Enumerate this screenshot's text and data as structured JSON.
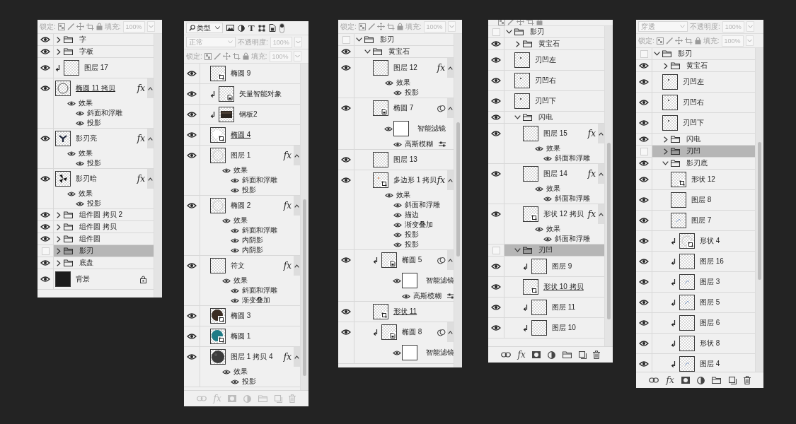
{
  "panels": [
    {
      "lock": {
        "label": "锁定:",
        "fill_label": "填充:",
        "fill": "100%"
      },
      "layers": [
        {
          "kind": "group",
          "name": "字",
          "expanded": false,
          "visible": true,
          "selected": false
        },
        {
          "kind": "group",
          "name": "字板",
          "expanded": false,
          "visible": true,
          "selected": false
        },
        {
          "kind": "layer",
          "name": "图层 17",
          "visible": true,
          "selected": false,
          "clipped": true,
          "thumb": {
            "kind": "checker"
          }
        },
        {
          "kind": "layer",
          "name": "椭圆 11 拷贝",
          "visible": true,
          "selected": false,
          "linked": true,
          "thumb": {
            "kind": "ring"
          },
          "badge": "fx",
          "effects": {
            "label": "效果",
            "items": [
              "斜面和浮雕",
              "投影"
            ]
          }
        },
        {
          "kind": "layer",
          "name": "影刃亮",
          "visible": true,
          "selected": false,
          "thumb": {
            "kind": "blade"
          },
          "badge": "fx",
          "effects": {
            "label": "效果",
            "items": [
              "投影"
            ]
          }
        },
        {
          "kind": "layer",
          "name": "影刃暗",
          "visible": true,
          "selected": false,
          "thumb": {
            "kind": "fan"
          },
          "badge": "fx",
          "effects": {
            "label": "效果",
            "items": [
              "投影"
            ]
          }
        },
        {
          "kind": "group",
          "name": "组件圆 拷贝 2",
          "expanded": false,
          "visible": true,
          "selected": false
        },
        {
          "kind": "group",
          "name": "组件圆 拷贝",
          "expanded": false,
          "visible": true,
          "selected": false
        },
        {
          "kind": "group",
          "name": "组件圆",
          "expanded": false,
          "visible": true,
          "selected": false
        },
        {
          "kind": "group",
          "name": "影刃",
          "expanded": false,
          "visible": false,
          "selected": true
        },
        {
          "kind": "group",
          "name": "底盘",
          "expanded": false,
          "visible": true,
          "selected": false
        },
        {
          "kind": "layer",
          "name": "背景",
          "visible": true,
          "selected": false,
          "thumb": {
            "kind": "black"
          },
          "locked": true
        }
      ]
    },
    {
      "filter": {
        "label": "类型",
        "text_filter": "T",
        "on": true
      },
      "blend": {
        "mode": "正常",
        "opacity_label": "不透明度:",
        "opacity": "100%"
      },
      "lock": {
        "label": "锁定:",
        "fill_label": "填充:",
        "fill": "100%"
      },
      "layers": [
        {
          "kind": "layer",
          "name": "椭圆 9",
          "visible": true,
          "selected": false,
          "thumb": {
            "kind": "checker",
            "shape": true
          }
        },
        {
          "kind": "layer",
          "name": "矢量智能对象",
          "visible": true,
          "selected": false,
          "clipped": true,
          "thumb": {
            "kind": "checker",
            "smart": true
          }
        },
        {
          "kind": "layer",
          "name": "钢板2",
          "visible": true,
          "selected": false,
          "clipped": true,
          "thumb": {
            "kind": "plate"
          }
        },
        {
          "kind": "layer",
          "name": "椭圆 4",
          "visible": true,
          "selected": false,
          "linked": true,
          "thumb": {
            "kind": "circle-white",
            "shape": true
          }
        },
        {
          "kind": "layer",
          "name": "图层 1",
          "visible": true,
          "selected": false,
          "thumb": {
            "kind": "faint-ring"
          },
          "badge": "fx",
          "effects": {
            "label": "效果",
            "items": [
              "斜面和浮雕",
              "投影"
            ]
          }
        },
        {
          "kind": "layer",
          "name": "椭圆 2",
          "visible": true,
          "selected": false,
          "thumb": {
            "kind": "faint-ring"
          },
          "badge": "fx",
          "effects": {
            "label": "效果",
            "items": [
              "斜面和浮雕",
              "内阴影",
              "内阴影"
            ]
          }
        },
        {
          "kind": "layer",
          "name": "符文",
          "visible": true,
          "selected": false,
          "thumb": {
            "kind": "checker"
          },
          "badge": "fx",
          "effects": {
            "label": "效果",
            "items": [
              "斜面和浮雕",
              "渐变叠加"
            ]
          }
        },
        {
          "kind": "layer",
          "name": "椭圆 3",
          "visible": true,
          "selected": false,
          "thumb": {
            "kind": "circle-brown",
            "shape": true
          }
        },
        {
          "kind": "layer",
          "name": "椭圆 1",
          "visible": true,
          "selected": false,
          "thumb": {
            "kind": "circle-teal",
            "shape": true
          }
        },
        {
          "kind": "layer",
          "name": "图层 1 拷贝 4",
          "visible": true,
          "selected": false,
          "thumb": {
            "kind": "circle-dark"
          },
          "badge": "fx",
          "effects": {
            "label": "效果",
            "items": [
              "投影"
            ]
          }
        }
      ],
      "footer": {
        "fx": "fx",
        "disabled": true
      }
    },
    {
      "lock": {
        "label": "锁定:",
        "fill_label": "填充:",
        "fill": "100%"
      },
      "layers": [
        {
          "kind": "group",
          "name": "影刃",
          "expanded": true,
          "visible": false,
          "selected": false,
          "children": [
            {
              "kind": "group",
              "name": "黄宝石",
              "expanded": true,
              "visible": true,
              "selected": false,
              "children": [
                {
                  "kind": "layer",
                  "name": "图层 12",
                  "visible": true,
                  "selected": false,
                  "thumb": {
                    "kind": "checker"
                  },
                  "badge": "fx",
                  "effects": {
                    "label": "效果",
                    "items": [
                      "投影"
                    ]
                  }
                },
                {
                  "kind": "layer",
                  "name": "椭圆 7",
                  "visible": true,
                  "selected": false,
                  "thumb": {
                    "kind": "checker",
                    "smart": true
                  },
                  "smart_filter": {
                    "label": "智能滤镜",
                    "items": [
                      "高斯模糊"
                    ]
                  }
                },
                {
                  "kind": "layer",
                  "name": "图层 13",
                  "visible": true,
                  "selected": false,
                  "thumb": {
                    "kind": "checker"
                  }
                },
                {
                  "kind": "layer",
                  "name": "多边形 1 拷贝",
                  "visible": true,
                  "selected": false,
                  "thumb": {
                    "kind": "orange-dot",
                    "shape": true
                  },
                  "badge": "fx",
                  "effects": {
                    "label": "效果",
                    "items": [
                      "斜面和浮雕",
                      "描边",
                      "渐变叠加",
                      "投影",
                      "投影"
                    ]
                  }
                },
                {
                  "kind": "layer",
                  "name": "椭圆 5",
                  "visible": true,
                  "selected": false,
                  "clipped": true,
                  "thumb": {
                    "kind": "checker",
                    "smart": true
                  },
                  "smart_filter": {
                    "label": "智能滤镜",
                    "items": [
                      "高斯模糊"
                    ]
                  }
                },
                {
                  "kind": "layer",
                  "name": "形状 11",
                  "visible": true,
                  "selected": false,
                  "linked": true,
                  "thumb": {
                    "kind": "checker",
                    "shape": true
                  }
                },
                {
                  "kind": "layer",
                  "name": "椭圆 8",
                  "visible": true,
                  "selected": false,
                  "clipped": true,
                  "thumb": {
                    "kind": "checker",
                    "smart": true
                  },
                  "smart_filter": {
                    "label": "智能滤镜"
                  }
                }
              ]
            }
          ]
        }
      ]
    },
    {
      "lock": {
        "cut": true
      },
      "layers": [
        {
          "kind": "group",
          "name": "影刃",
          "expanded": true,
          "visible": false,
          "selected": false,
          "children": [
            {
              "kind": "group",
              "name": "黄宝石",
              "expanded": false,
              "visible": true,
              "selected": false
            },
            {
              "kind": "layer",
              "name": "刃凹左",
              "visible": true,
              "selected": false,
              "thumb": {
                "kind": "dot"
              }
            },
            {
              "kind": "layer",
              "name": "刃凹右",
              "visible": true,
              "selected": false,
              "thumb": {
                "kind": "dot"
              }
            },
            {
              "kind": "layer",
              "name": "刃凹下",
              "visible": true,
              "selected": false,
              "thumb": {
                "kind": "dot"
              }
            },
            {
              "kind": "group",
              "name": "闪电",
              "expanded": true,
              "visible": true,
              "selected": false,
              "children": [
                {
                  "kind": "layer",
                  "name": "图层 15",
                  "visible": true,
                  "selected": false,
                  "thumb": {
                    "kind": "checker"
                  },
                  "badge": "fx",
                  "effects": {
                    "label": "效果",
                    "items": [
                      "斜面和浮雕"
                    ]
                  }
                },
                {
                  "kind": "layer",
                  "name": "图层 14",
                  "visible": true,
                  "selected": false,
                  "thumb": {
                    "kind": "checker"
                  },
                  "badge": "fx",
                  "effects": {
                    "label": "效果",
                    "items": [
                      "斜面和浮雕"
                    ]
                  }
                },
                {
                  "kind": "layer",
                  "name": "形状 12 拷贝",
                  "visible": true,
                  "selected": false,
                  "thumb": {
                    "kind": "checker",
                    "shape": true
                  },
                  "badge": "fx",
                  "effects": {
                    "label": "效果",
                    "items": [
                      "斜面和浮雕"
                    ]
                  }
                }
              ]
            },
            {
              "kind": "group",
              "name": "刃凹",
              "expanded": true,
              "visible": false,
              "selected": true,
              "children": [
                {
                  "kind": "layer",
                  "name": "图层 9",
                  "visible": true,
                  "selected": false,
                  "clipped": true,
                  "thumb": {
                    "kind": "checker"
                  }
                },
                {
                  "kind": "layer",
                  "name": "形状 10 拷贝",
                  "visible": true,
                  "selected": false,
                  "linked": true,
                  "thumb": {
                    "kind": "checker",
                    "shape": true
                  }
                },
                {
                  "kind": "layer",
                  "name": "图层 11",
                  "visible": true,
                  "selected": false,
                  "clipped": true,
                  "thumb": {
                    "kind": "checker"
                  }
                },
                {
                  "kind": "layer",
                  "name": "图层 10",
                  "visible": true,
                  "selected": false,
                  "clipped": true,
                  "thumb": {
                    "kind": "checker"
                  }
                }
              ]
            }
          ]
        }
      ],
      "footer": {
        "fx": "fx",
        "disabled": false
      }
    },
    {
      "blend": {
        "mode": "穿透",
        "opacity_label": "不透明度:",
        "opacity": "100%"
      },
      "lock": {
        "label": "锁定:",
        "fill_label": "填充:",
        "fill": "100%"
      },
      "layers": [
        {
          "kind": "group",
          "name": "影刃",
          "expanded": true,
          "visible": false,
          "selected": false,
          "children": [
            {
              "kind": "group",
              "name": "黄宝石",
              "expanded": false,
              "visible": true,
              "selected": false
            },
            {
              "kind": "layer",
              "name": "刃凹左",
              "visible": true,
              "selected": false,
              "thumb": {
                "kind": "dot"
              }
            },
            {
              "kind": "layer",
              "name": "刃凹右",
              "visible": true,
              "selected": false,
              "thumb": {
                "kind": "dot"
              }
            },
            {
              "kind": "layer",
              "name": "刃凹下",
              "visible": true,
              "selected": false,
              "thumb": {
                "kind": "dot"
              }
            },
            {
              "kind": "group",
              "name": "闪电",
              "expanded": false,
              "visible": true,
              "selected": false
            },
            {
              "kind": "group",
              "name": "刃凹",
              "expanded": false,
              "visible": false,
              "selected": true
            },
            {
              "kind": "group",
              "name": "影刃底",
              "expanded": true,
              "visible": true,
              "selected": false,
              "children": [
                {
                  "kind": "layer",
                  "name": "形状 12",
                  "visible": true,
                  "selected": false,
                  "thumb": {
                    "kind": "checker",
                    "shape": true
                  }
                },
                {
                  "kind": "layer",
                  "name": "图层 8",
                  "visible": true,
                  "selected": false,
                  "thumb": {
                    "kind": "checker"
                  }
                },
                {
                  "kind": "layer",
                  "name": "图层 7",
                  "visible": true,
                  "selected": false,
                  "thumb": {
                    "kind": "sketch"
                  }
                },
                {
                  "kind": "layer",
                  "name": "形状 4",
                  "visible": true,
                  "selected": false,
                  "clipped": true,
                  "thumb": {
                    "kind": "faint-ring",
                    "shape": true
                  }
                },
                {
                  "kind": "layer",
                  "name": "图层 16",
                  "visible": true,
                  "selected": false,
                  "clipped": true,
                  "thumb": {
                    "kind": "checker"
                  }
                },
                {
                  "kind": "layer",
                  "name": "图层 3",
                  "visible": true,
                  "selected": false,
                  "clipped": true,
                  "thumb": {
                    "kind": "sketch"
                  }
                },
                {
                  "kind": "layer",
                  "name": "图层 5",
                  "visible": true,
                  "selected": false,
                  "clipped": true,
                  "thumb": {
                    "kind": "sketch"
                  }
                },
                {
                  "kind": "layer",
                  "name": "图层 6",
                  "visible": true,
                  "selected": false,
                  "clipped": true,
                  "thumb": {
                    "kind": "checker"
                  }
                },
                {
                  "kind": "layer",
                  "name": "形状 8",
                  "visible": true,
                  "selected": false,
                  "clipped": true,
                  "thumb": {
                    "kind": "checker"
                  }
                },
                {
                  "kind": "layer",
                  "name": "图层 4",
                  "visible": true,
                  "selected": false,
                  "clipped": true,
                  "thumb": {
                    "kind": "sketch"
                  }
                }
              ]
            }
          ]
        }
      ],
      "footer": {
        "fx": "fx",
        "disabled": false
      }
    }
  ]
}
